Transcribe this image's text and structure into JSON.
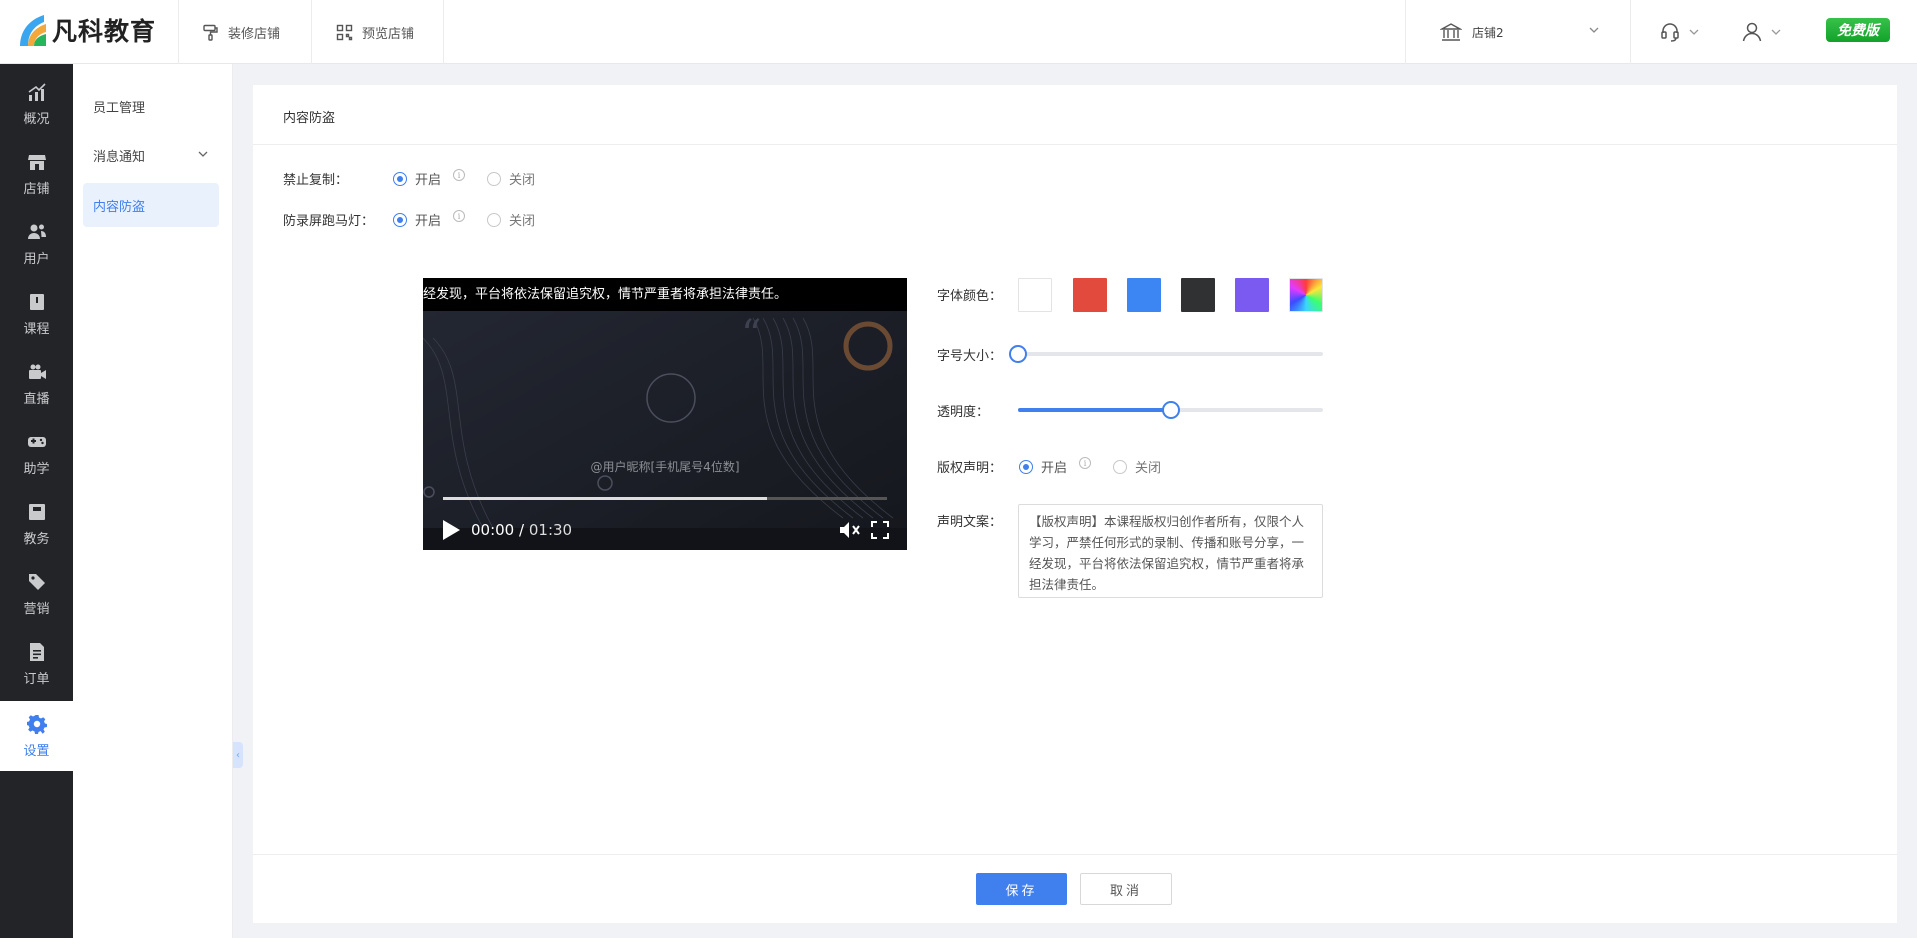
{
  "brand": {
    "name": "凡科教育"
  },
  "topbar": {
    "decorate_label": "装修店铺",
    "preview_label": "预览店铺",
    "store_name": "店铺2",
    "badge_label": "免费版"
  },
  "leftnav": {
    "items": [
      {
        "label": "概况",
        "icon": "chart-icon"
      },
      {
        "label": "店铺",
        "icon": "store-icon"
      },
      {
        "label": "用户",
        "icon": "users-icon"
      },
      {
        "label": "课程",
        "icon": "book-icon"
      },
      {
        "label": "直播",
        "icon": "video-camera-icon"
      },
      {
        "label": "助学",
        "icon": "gamepad-icon"
      },
      {
        "label": "教务",
        "icon": "folder-icon"
      },
      {
        "label": "营销",
        "icon": "tag-icon"
      },
      {
        "label": "订单",
        "icon": "document-icon"
      },
      {
        "label": "设置",
        "icon": "gear-icon",
        "active": true
      }
    ]
  },
  "subnav": {
    "items": [
      {
        "label": "员工管理"
      },
      {
        "label": "消息通知"
      },
      {
        "label": "内容防盗",
        "active": true
      }
    ]
  },
  "page": {
    "title": "内容防盗",
    "forbid_copy": {
      "label": "禁止复制：",
      "on": "开启",
      "off": "关闭",
      "value": "开启"
    },
    "anti_record": {
      "label": "防录屏跑马灯：",
      "on": "开启",
      "off": "关闭",
      "value": "开启"
    }
  },
  "video": {
    "marquee_text": "经发现，平台将依法保留追究权，情节严重者将承担法律责任。",
    "watermark_text": "@用户昵称[手机尾号4位数]",
    "current_time": "00:00",
    "separator": "/",
    "total_time": "01:30",
    "progress": 0.73
  },
  "style_settings": {
    "font_color_label": "字体颜色：",
    "swatches": [
      "#ffffff",
      "#e34a3e",
      "#3b86f2",
      "#303133",
      "#7a5af0",
      "rainbow"
    ],
    "font_size_label": "字号大小：",
    "font_size_value": 0,
    "opacity_label": "透明度：",
    "opacity_value": 0.5,
    "copyright_label": "版权声明：",
    "copyright_on": "开启",
    "copyright_off": "关闭",
    "copyright_value": "开启",
    "statement_label": "声明文案：",
    "statement_text": "【版权声明】本课程版权归创作者所有，仅限个人学习，严禁任何形式的录制、传播和账号分享，一经发现，平台将依法保留追究权，情节严重者将承担法律责任。"
  },
  "footer": {
    "save_label": "保存",
    "cancel_label": "取消"
  },
  "colors": {
    "accent": "#3f7fee",
    "nav_bg": "#232428",
    "badge": "#1aa82c"
  }
}
